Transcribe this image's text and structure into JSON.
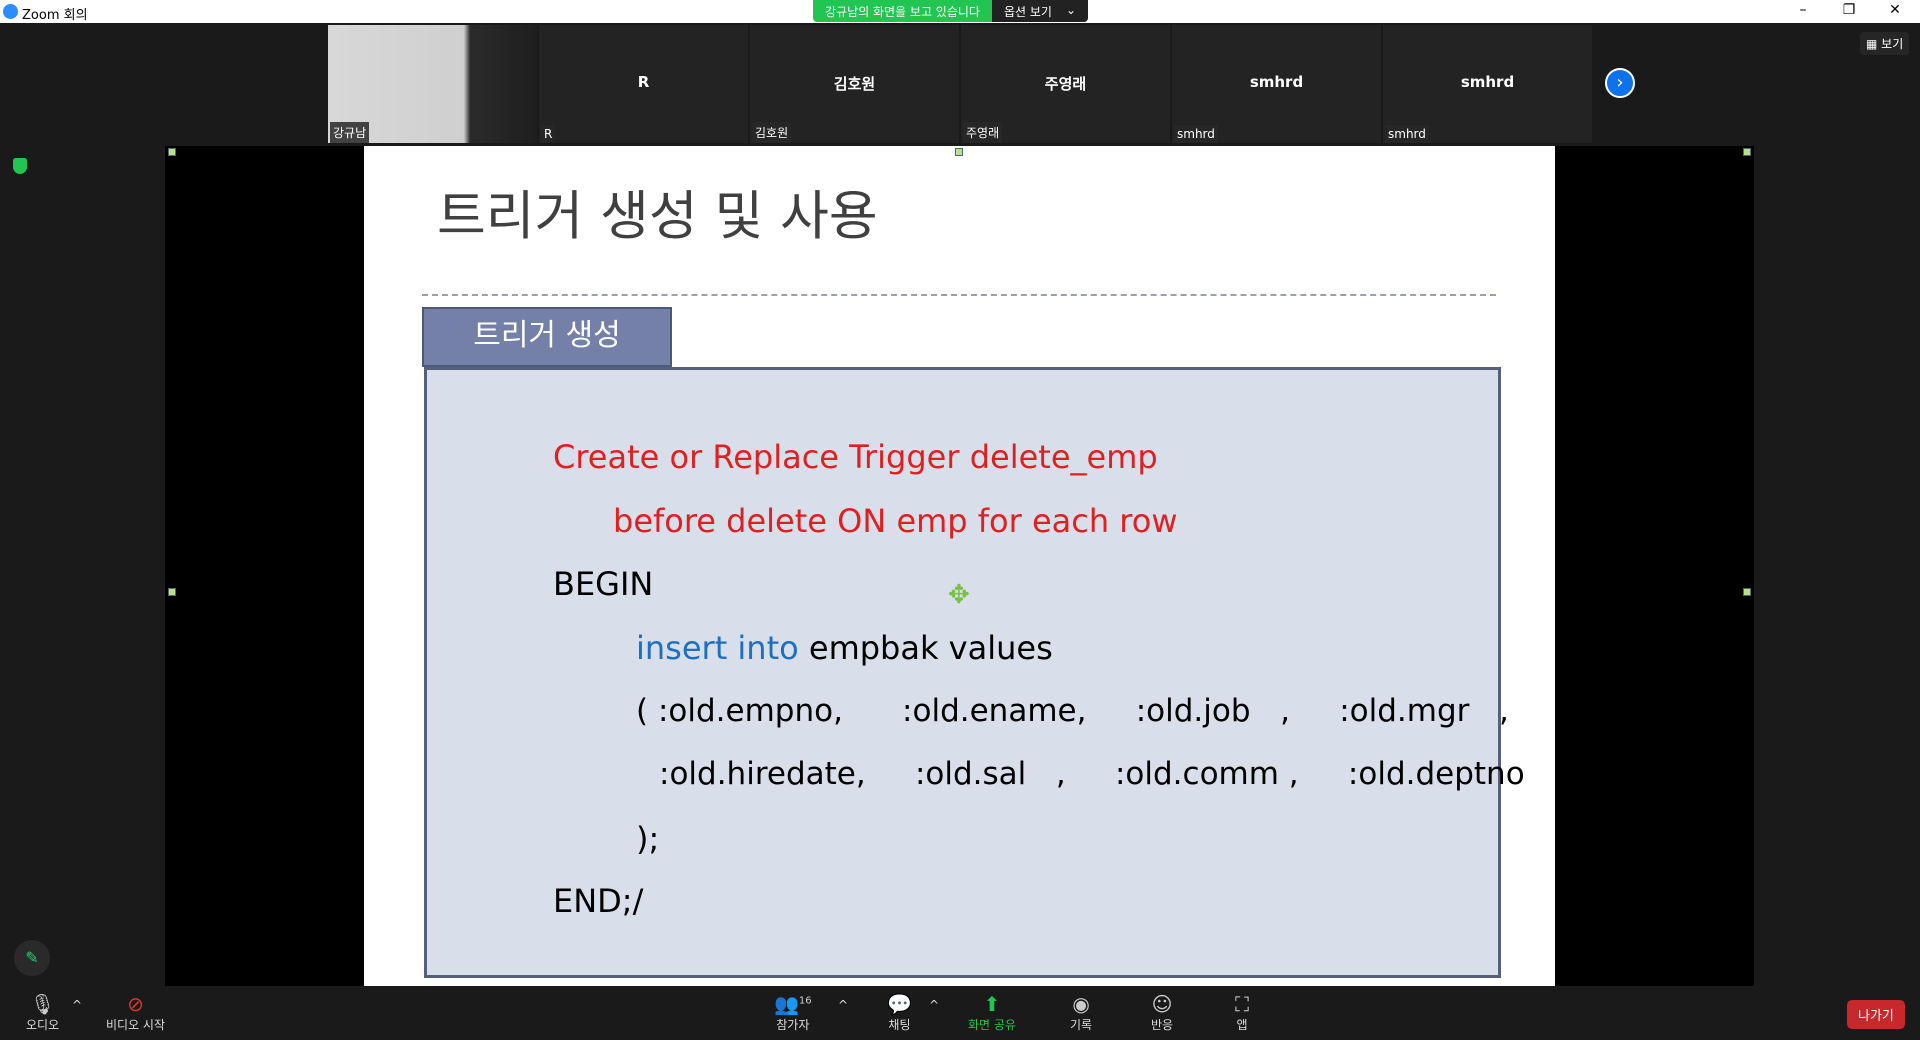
{
  "window": {
    "title": "Zoom 회의",
    "minimize": "–",
    "restore": "❐",
    "close": "✕"
  },
  "share_banner": {
    "text": "강규남의 화면을 보고 있습니다",
    "options": "옵션 보기",
    "chevron": "⌄"
  },
  "participants": [
    {
      "name": "",
      "label": "강규남"
    },
    {
      "name": "R",
      "label": "R"
    },
    {
      "name": "김호원",
      "label": "김호원"
    },
    {
      "name": "주영래",
      "label": "주영래"
    },
    {
      "name": "smhrd",
      "label": "smhrd"
    },
    {
      "name": "smhrd",
      "label": "smhrd"
    }
  ],
  "view_button": "▦ 보기",
  "next_icon": "›",
  "slide": {
    "title": "트리거 생성 및 사용",
    "tab": "트리거 생성",
    "code": [
      {
        "text": "Create or Replace Trigger delete_emp",
        "color": "red"
      },
      {
        "text": "before delete ON emp for each row",
        "color": "red"
      },
      {
        "text": "BEGIN"
      },
      {
        "kw": "insert into",
        "text": " empbak values"
      },
      {
        "text": "( :old.empno,      :old.ename,     :old.job   ,     :old.mgr   ,"
      },
      {
        "text": ":old.hiredate,     :old.sal   ,     :old.comm ,     :old.deptno"
      },
      {
        "text": ");"
      },
      {
        "text": "END;/"
      }
    ]
  },
  "toolbar": {
    "audio": "오디오",
    "video": "비디오 시작",
    "participants": "참가자",
    "participant_count": "16",
    "chat": "채팅",
    "share": "화면 공유",
    "record": "기록",
    "reactions": "반응",
    "apps": "앱",
    "leave": "나가기"
  },
  "colors": {
    "share_green": "#23c552",
    "leave_red": "#c8282c",
    "code_red": "#e02020",
    "code_blue": "#1d6fc0",
    "box_fill": "#d9dfea",
    "tab_fill": "#7480a8"
  }
}
